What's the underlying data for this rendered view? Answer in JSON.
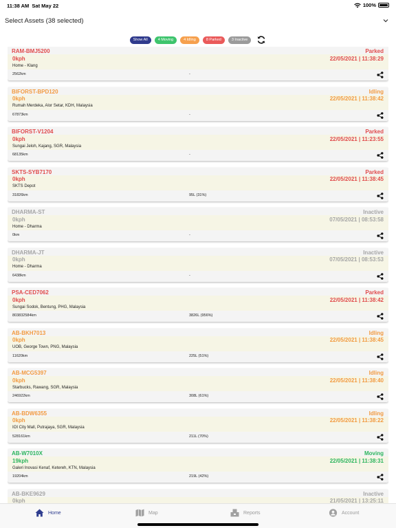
{
  "status_bar": {
    "time": "11:38 AM",
    "date": "Sat May 22",
    "battery": "100%"
  },
  "selector": {
    "label": "Select Assets (38 selected)"
  },
  "filters": [
    {
      "label": "Show All",
      "color": "#2f3a8c"
    },
    {
      "label": "4 Moving",
      "color": "#3ec46d"
    },
    {
      "label": "4 Idling",
      "color": "#f6a04d"
    },
    {
      "label": "8 Parked",
      "color": "#ea5a5a"
    },
    {
      "label": "3 Inactive",
      "color": "#9b9b9b"
    }
  ],
  "status_colors": {
    "Parked": "#e04b4b",
    "Idling": "#f29a3f",
    "Inactive": "#a5a5a5",
    "Moving": "#2bb45c"
  },
  "vehicles": [
    {
      "plate": "RAM-BMJ5200",
      "status": "Parked",
      "speed": "0kph",
      "time": "22/05/2021 | 11:38:29",
      "address": "Home - Klang",
      "odometer": "2562km",
      "fuel": "-"
    },
    {
      "plate": "BIFORST-BPD120",
      "status": "Idling",
      "speed": "0kph",
      "time": "22/05/2021 | 11:38:42",
      "address": "Rumah Merdeka, Alor Setar, KDH, Malaysia",
      "odometer": "67873km",
      "fuel": "-"
    },
    {
      "plate": "BIFORST-V1204",
      "status": "Parked",
      "speed": "0kph",
      "time": "22/05/2021 | 11:23:55",
      "address": "Sungai Jeloh, Kajang, SGR, Malaysia",
      "odometer": "68135km",
      "fuel": "-"
    },
    {
      "plate": "SKTS-SYB7170",
      "status": "Parked",
      "speed": "0kph",
      "time": "22/05/2021 | 11:38:45",
      "address": "SKTS Depot",
      "odometer": "31826km",
      "fuel": "95L (31%)"
    },
    {
      "plate": "DHARMA-ST",
      "status": "Inactive",
      "speed": "0kph",
      "time": "07/05/2021 | 08:53:58",
      "address": "Home - Dharma",
      "odometer": "0km",
      "fuel": "-"
    },
    {
      "plate": "DHARMA-JT",
      "status": "Inactive",
      "speed": "0kph",
      "time": "07/05/2021 | 08:53:53",
      "address": "Home - Dharma",
      "odometer": "6438km",
      "fuel": "-"
    },
    {
      "plate": "PSA-CED7062",
      "status": "Parked",
      "speed": "0kph",
      "time": "22/05/2021 | 11:38:42",
      "address": "Sungai Sodok, Bentung, PHG, Malaysia",
      "odometer": "803832584km",
      "fuel": "3826L (956%)"
    },
    {
      "plate": "AB-BKH7013",
      "status": "Idling",
      "speed": "0kph",
      "time": "22/05/2021 | 11:38:45",
      "address": "UOB, George Town, PNG, Malaysia",
      "odometer": "11620km",
      "fuel": "225L (51%)"
    },
    {
      "plate": "AB-MCG5397",
      "status": "Idling",
      "speed": "0kph",
      "time": "22/05/2021 | 11:38:40",
      "address": "Starbucks, Rawang, SGR, Malaysia",
      "odometer": "246922km",
      "fuel": "308L (61%)"
    },
    {
      "plate": "AB-BDW6355",
      "status": "Idling",
      "speed": "0kph",
      "time": "22/05/2021 | 11:38:22",
      "address": "IOI City Mall, Putrajaya, SGR, Malaysia",
      "odometer": "528161km",
      "fuel": "211L (70%)"
    },
    {
      "plate": "AB-W7010X",
      "status": "Moving",
      "speed": "19kph",
      "time": "22/05/2021 | 11:38:31",
      "address": "Galeri Inovasi Kenaf, Ketereh, KTN, Malaysia",
      "odometer": "19204km",
      "fuel": "219L (42%)"
    },
    {
      "plate": "AB-BKE9629",
      "status": "Inactive",
      "speed": "0kph",
      "time": "21/05/2021 | 13:25:11",
      "address": "",
      "odometer": "",
      "fuel": ""
    }
  ],
  "tabs": [
    {
      "label": "Home",
      "icon": "home-icon"
    },
    {
      "label": "Map",
      "icon": "map-icon"
    },
    {
      "label": "Reports",
      "icon": "reports-icon"
    },
    {
      "label": "Account",
      "icon": "account-icon"
    }
  ]
}
